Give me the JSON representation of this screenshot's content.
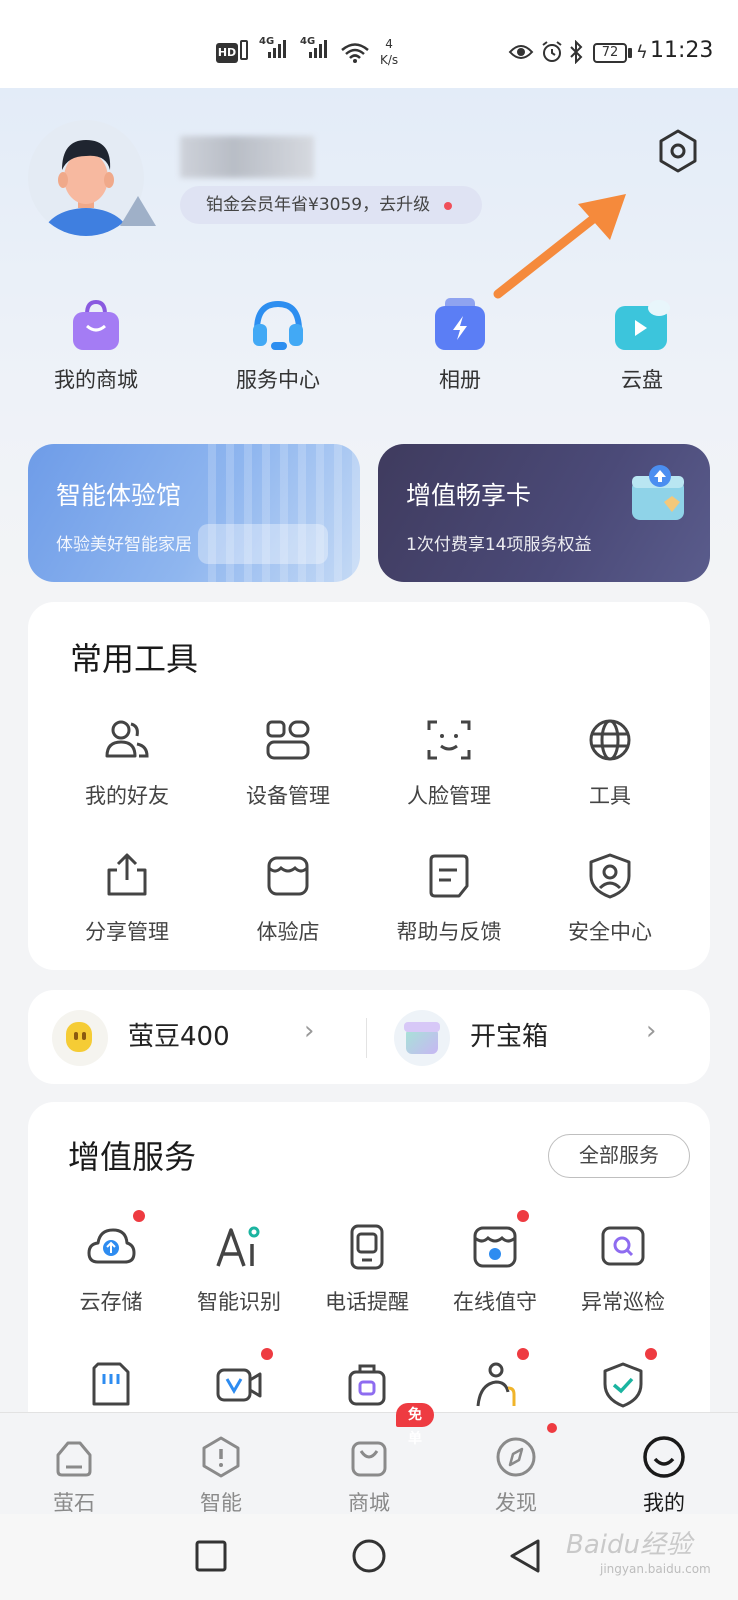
{
  "status_bar": {
    "hd": "HD",
    "sim1": "4G",
    "sim2": "4G",
    "net_speed": "4",
    "net_unit": "K/s",
    "battery": "72",
    "time": "11:23"
  },
  "profile": {
    "member_text": "铂金会员年省¥3059，去升级"
  },
  "quick_links": [
    {
      "label": "我的商城",
      "icon": "shopping-bag-icon",
      "color": "#9b6cf0"
    },
    {
      "label": "服务中心",
      "icon": "headset-icon",
      "color": "#3fa4f2"
    },
    {
      "label": "相册",
      "icon": "album-icon",
      "color": "#5b7ef5"
    },
    {
      "label": "云盘",
      "icon": "cloud-drive-icon",
      "color": "#3cc5dc"
    }
  ],
  "banners": [
    {
      "title": "智能体验馆",
      "subtitle": "体验美好智能家居"
    },
    {
      "title": "增值畅享卡",
      "subtitle": "1次付费享14项服务权益"
    }
  ],
  "common_tools": {
    "title": "常用工具",
    "items": [
      {
        "label": "我的好友",
        "icon": "friends-icon"
      },
      {
        "label": "设备管理",
        "icon": "device-manage-icon"
      },
      {
        "label": "人脸管理",
        "icon": "face-scan-icon"
      },
      {
        "label": "工具",
        "icon": "globe-icon"
      },
      {
        "label": "分享管理",
        "icon": "share-icon"
      },
      {
        "label": "体验店",
        "icon": "store-icon"
      },
      {
        "label": "帮助与反馈",
        "icon": "feedback-icon"
      },
      {
        "label": "安全中心",
        "icon": "security-icon"
      }
    ]
  },
  "rewards": {
    "beans": "萤豆400",
    "treasure": "开宝箱"
  },
  "value_services": {
    "title": "增值服务",
    "all_button": "全部服务",
    "items": [
      {
        "label": "云存储",
        "icon": "cloud-upload-icon",
        "badge": true
      },
      {
        "label": "智能识别",
        "icon": "ai-icon",
        "badge": false
      },
      {
        "label": "电话提醒",
        "icon": "phone-icon",
        "badge": false
      },
      {
        "label": "在线值守",
        "icon": "online-guard-icon",
        "badge": true
      },
      {
        "label": "异常巡检",
        "icon": "inspection-icon",
        "badge": false
      },
      {
        "label": "",
        "icon": "sd-card-icon",
        "badge": false
      },
      {
        "label": "",
        "icon": "video-icon",
        "badge": true
      },
      {
        "label": "",
        "icon": "luggage-icon",
        "badge": false
      },
      {
        "label": "",
        "icon": "elderly-icon",
        "badge": true
      },
      {
        "label": "",
        "icon": "shield-check-icon",
        "badge": true
      }
    ]
  },
  "tab_bar": {
    "free_badge": "免单",
    "items": [
      {
        "label": "萤石",
        "icon": "home-icon",
        "active": false
      },
      {
        "label": "智能",
        "icon": "smart-icon",
        "active": false
      },
      {
        "label": "商城",
        "icon": "mall-icon",
        "active": false
      },
      {
        "label": "发现",
        "icon": "compass-icon",
        "active": false,
        "badge": true
      },
      {
        "label": "我的",
        "icon": "me-icon",
        "active": true
      }
    ]
  },
  "watermark": {
    "text": "Baidu经验",
    "sub": "jingyan.baidu.com"
  }
}
